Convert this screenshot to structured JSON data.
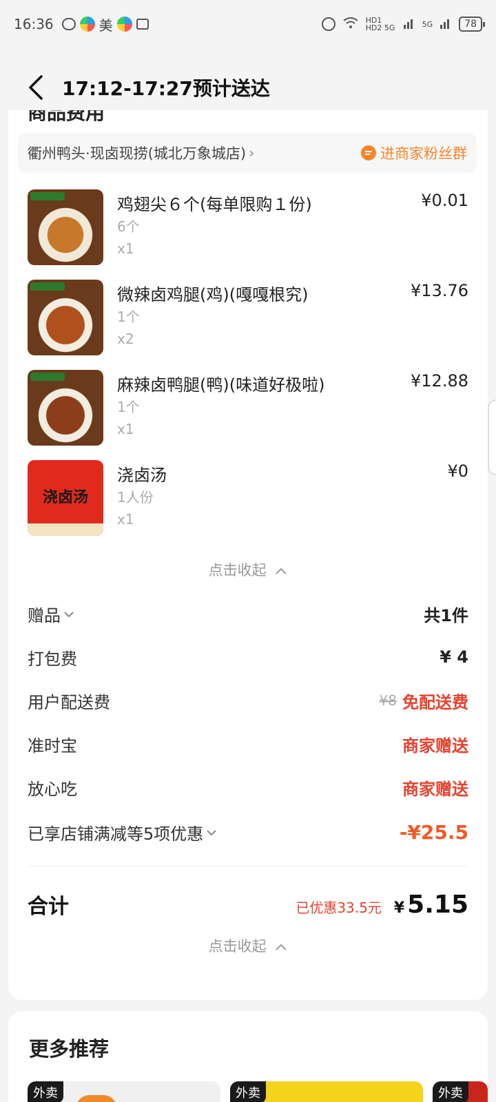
{
  "status_bar": {
    "time": "16:36",
    "app_label": "美",
    "network_1": "HD1 HD2 5G",
    "network_2": "5G",
    "battery": "78"
  },
  "header": {
    "title": "17:12-17:27预计送达"
  },
  "card": {
    "cut_heading": "商品费用",
    "store_name": "衢州鸭头·现卤现捞(城北万象城店)",
    "fan_group": "进商家粉丝群"
  },
  "items": [
    {
      "name": "鸡翅尖６个(每单限购１份)",
      "spec": "6个",
      "qty": "x1",
      "price": "¥0.01"
    },
    {
      "name": "微辣卤鸡腿(鸡)(嘎嘎根究)",
      "spec": "1个",
      "qty": "x2",
      "price": "¥13.76"
    },
    {
      "name": "麻辣卤鸭腿(鸭)(味道好极啦)",
      "spec": "1个",
      "qty": "x1",
      "price": "¥12.88"
    },
    {
      "name": "浇卤汤",
      "spec": "1人份",
      "qty": "x1",
      "price": "¥0",
      "thumb_text": "浇卤汤"
    }
  ],
  "collapse_label": "点击收起",
  "fees": {
    "gift": {
      "label": "赠品",
      "value": "共1件"
    },
    "packing": {
      "label": "打包费",
      "value": "¥ 4"
    },
    "delivery": {
      "label": "用户配送费",
      "original": "¥8",
      "value": "免配送费"
    },
    "ontime": {
      "label": "准时宝",
      "value": "商家赠送"
    },
    "safe": {
      "label": "放心吃",
      "value": "商家赠送"
    },
    "discount": {
      "label": "已享店铺满减等5项优惠",
      "value": "-¥25.5"
    }
  },
  "total": {
    "label": "合计",
    "saved": "已优惠33.5元",
    "currency": "¥",
    "amount": "5.15"
  },
  "recommend": {
    "title": "更多推荐",
    "tag": "外卖"
  },
  "colors": {
    "accent_orange": "#f5862c",
    "accent_red": "#e5432f"
  }
}
